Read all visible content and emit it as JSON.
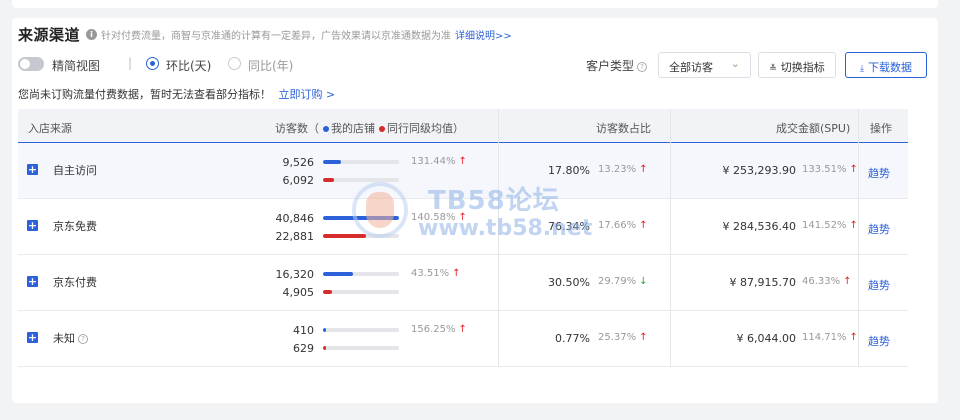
{
  "header": {
    "title": "来源渠道",
    "description": "针对付费流量，商智与京准通的计算有一定差异，广告效果请以京准通数据为准",
    "detail_link": "详细说明>>"
  },
  "controls": {
    "toggle_label": "精简视图",
    "separator": "|",
    "radio_mom": "环比(天)",
    "radio_yoy": "同比(年)",
    "customer_type_label": "客户类型",
    "customer_type_value": "全部访客",
    "switch_metrics": "切换指标",
    "download": "下载数据"
  },
  "notice": {
    "text": "您尚未订购流量付费数据，暂时无法查看部分指标！",
    "link": "立即订购 >"
  },
  "table": {
    "headers": {
      "source": "入店来源",
      "visitors_prefix": "访客数（",
      "my_store": "我的店铺",
      "peer_avg": "同行同级均值",
      "visitors_suffix": "）",
      "visitor_share": "访客数占比",
      "amount": "成交金额(SPU)",
      "action": "操作"
    },
    "colors": {
      "my_store": "#2b62d9",
      "peer": "#d62c2c"
    },
    "rows": [
      {
        "source": "自主访问",
        "has_help": false,
        "my_visitors": "9,526",
        "my_visitors_value": 9526,
        "peer_visitors": "6,092",
        "peer_visitors_value": 6092,
        "visitor_change": "131.44%",
        "share": "17.80%",
        "share_change": "13.23%",
        "share_dir": "up",
        "amount": "¥ 253,293.90",
        "amount_change": "133.51%",
        "trend": "趋势"
      },
      {
        "source": "京东免费",
        "has_help": false,
        "my_visitors": "40,846",
        "my_visitors_value": 40846,
        "peer_visitors": "22,881",
        "peer_visitors_value": 22881,
        "visitor_change": "140.58%",
        "share": "76.34%",
        "share_change": "17.66%",
        "share_dir": "up",
        "amount": "¥ 284,536.40",
        "amount_change": "141.52%",
        "trend": "趋势"
      },
      {
        "source": "京东付费",
        "has_help": false,
        "my_visitors": "16,320",
        "my_visitors_value": 16320,
        "peer_visitors": "4,905",
        "peer_visitors_value": 4905,
        "visitor_change": "43.51%",
        "share": "30.50%",
        "share_change": "29.79%",
        "share_dir": "down",
        "amount": "¥ 87,915.70",
        "amount_change": "46.33%",
        "trend": "趋势"
      },
      {
        "source": "未知",
        "has_help": true,
        "my_visitors": "410",
        "my_visitors_value": 410,
        "peer_visitors": "629",
        "peer_visitors_value": 629,
        "visitor_change": "156.25%",
        "share": "0.77%",
        "share_change": "25.37%",
        "share_dir": "up",
        "amount": "¥ 6,044.00",
        "amount_change": "114.71%",
        "trend": "趋势"
      }
    ]
  },
  "watermark": {
    "line1": "TB58论坛",
    "line2": "www.tb58.net"
  }
}
